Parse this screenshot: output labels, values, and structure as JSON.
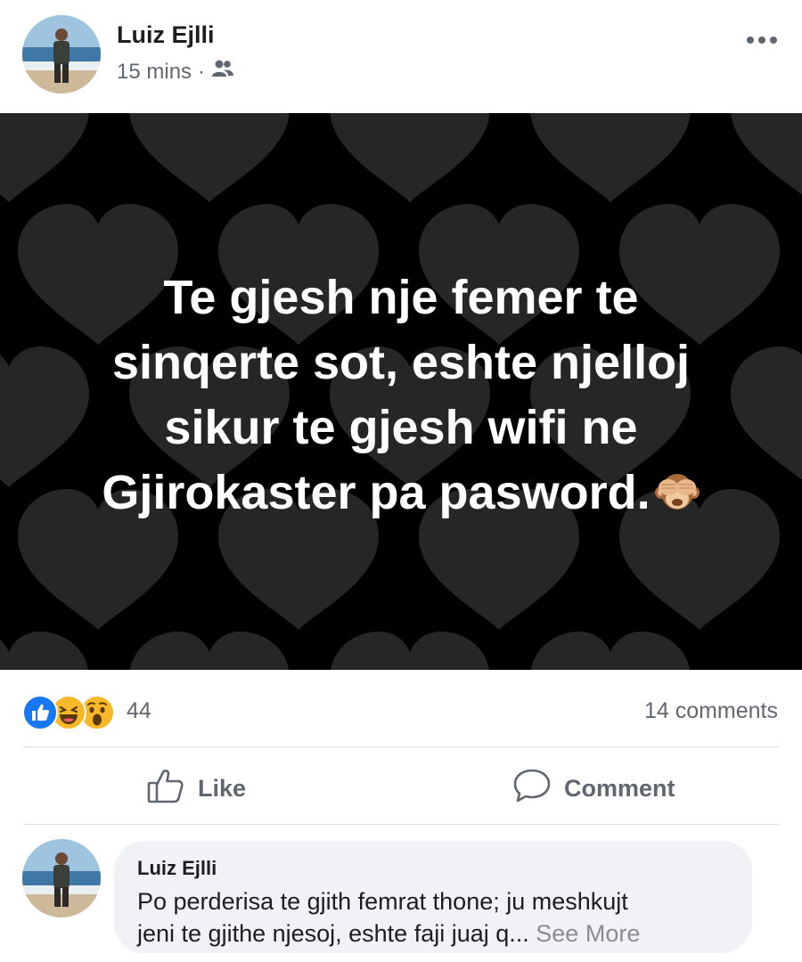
{
  "post": {
    "author": "Luiz Ejlli",
    "timestamp": "15 mins",
    "separator": "·",
    "audience_icon": "friends-icon",
    "more_icon": "more-horizontal-icon"
  },
  "image": {
    "background_color": "#000000",
    "heart_color": "#262626",
    "lines": [
      "Te gjesh nje femer te",
      "sinqerte sot, eshte njelloj",
      "sikur te gjesh wifi ne",
      "Gjirokaster pa pasword."
    ],
    "emoji": "see-no-evil-monkey"
  },
  "stats": {
    "reaction_icons": [
      "like-reaction-icon",
      "haha-reaction-icon",
      "wow-reaction-icon"
    ],
    "reactions_count": "44",
    "comments_count": "14 comments"
  },
  "actions": {
    "like": "Like",
    "comment": "Comment"
  },
  "comment": {
    "author": "Luiz Ejlli",
    "text_line1": "Po perderisa te gjith femrat thone; ju meshkujt",
    "text_line2": "jeni te gjithe njesoj, eshte faji juaj q...",
    "see_more": "See More"
  },
  "colors": {
    "like_blue": "#1877f2",
    "reaction_yellow": "#f7b928",
    "secondary_text": "#606770"
  }
}
